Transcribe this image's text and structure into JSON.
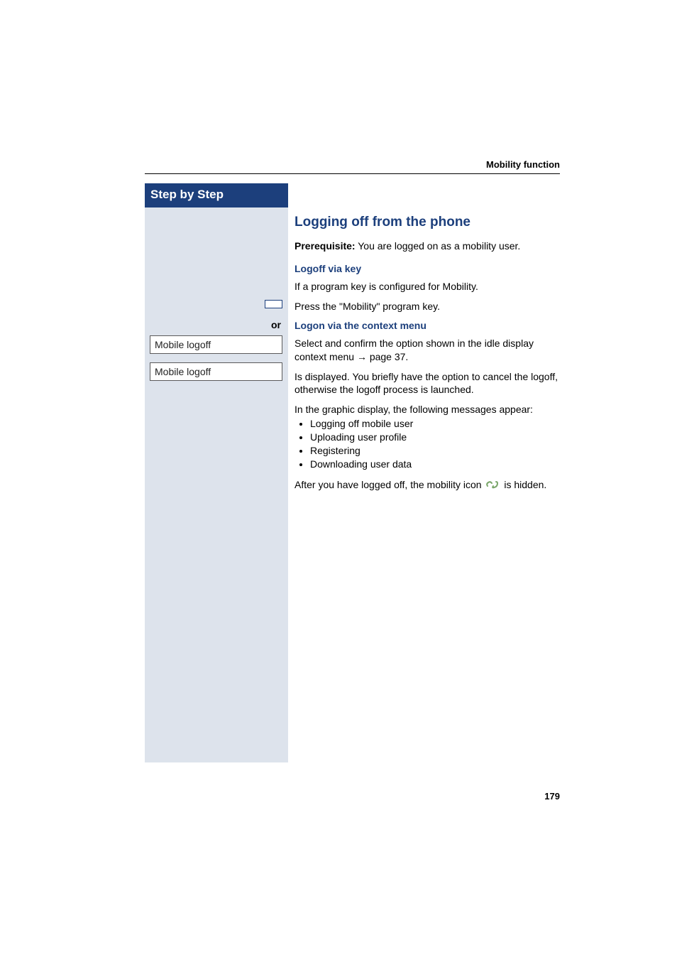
{
  "header": {
    "section": "Mobility function"
  },
  "sidebar": {
    "title": "Step by Step",
    "or_label": "or",
    "option1": "Mobile logoff",
    "option2": "Mobile logoff"
  },
  "main": {
    "title": "Logging off from the phone",
    "prereq_label": "Prerequisite:",
    "prereq_text": " You are logged on as a mobility user.",
    "sub1_title": "Logoff via key",
    "sub1_text1": "If a program key is configured for Mobility.",
    "sub1_text2": "Press the \"Mobility\" program key.",
    "sub2_title": "Logon via the context menu",
    "sub2_text1_a": "Select and confirm the option shown in the idle display context menu ",
    "sub2_text1_b": " page 37.",
    "sub2_text2": "Is displayed. You briefly have the option to cancel the logoff, otherwise the logoff process is launched.",
    "sub2_text3": "In the graphic display, the following messages appear:",
    "bullets": [
      "Logging off mobile user",
      "Uploading user profile",
      "Registering",
      "Downloading user data"
    ],
    "after_a": "After you have logged off, the mobility icon ",
    "after_b": " is hidden."
  },
  "page_number": "179"
}
